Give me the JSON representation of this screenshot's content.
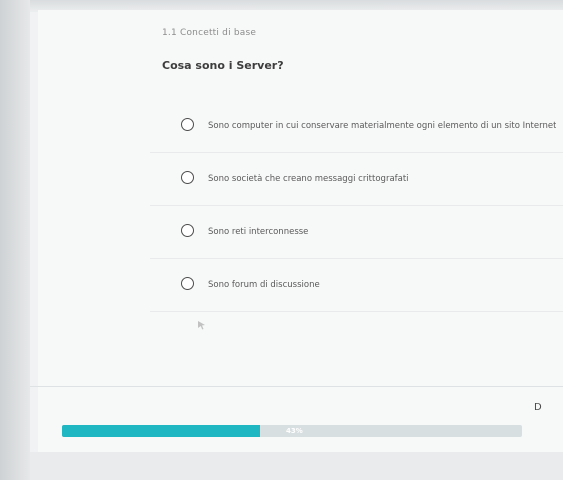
{
  "section": {
    "title": "1.1 Concetti di base"
  },
  "quiz": {
    "question": "Cosa sono i Server?",
    "options": [
      {
        "label": "Sono computer in cui conservare materialmente ogni elemento di un sito Internet"
      },
      {
        "label": "Sono società che creano messaggi crittografati"
      },
      {
        "label": "Sono reti interconnesse"
      },
      {
        "label": "Sono forum di discussione"
      }
    ]
  },
  "navigation": {
    "next_label": "D"
  },
  "progress": {
    "label": "43%",
    "value": 0.43
  },
  "colors": {
    "accent": "#1fb7c2",
    "background": "#f1f2f3",
    "text": "#4a4a4a"
  },
  "icons": {
    "cursor": "mouse-pointer-icon"
  }
}
